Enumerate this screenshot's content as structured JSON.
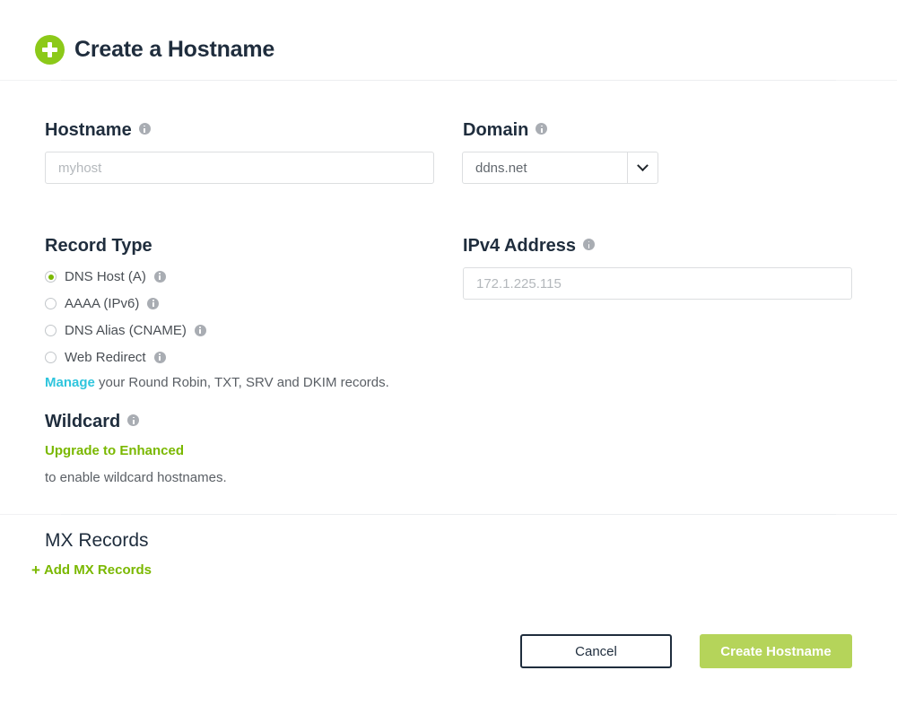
{
  "header": {
    "title": "Create a Hostname",
    "add_icon": "plus-circle-icon"
  },
  "form": {
    "hostname": {
      "label": "Hostname",
      "placeholder": "myhost",
      "value": ""
    },
    "domain": {
      "label": "Domain",
      "selected": "ddns.net",
      "chevron_icon": "chevron-down-icon"
    },
    "record_type": {
      "label": "Record Type",
      "options": [
        {
          "label": "DNS Host (A)",
          "selected": true
        },
        {
          "label": "AAAA (IPv6)",
          "selected": false
        },
        {
          "label": "DNS Alias (CNAME)",
          "selected": false
        },
        {
          "label": "Web Redirect",
          "selected": false
        }
      ],
      "manage_link": "Manage",
      "manage_text": " your Round Robin, TXT, SRV and DKIM records."
    },
    "ipv4": {
      "label": "IPv4 Address",
      "placeholder": "172.1.225.115",
      "value": ""
    },
    "wildcard": {
      "label": "Wildcard",
      "upgrade_link": "Upgrade to Enhanced",
      "note": "to enable wildcard hostnames."
    },
    "mx": {
      "title": "MX Records",
      "add_label": "Add MX Records",
      "add_icon": "plus-icon"
    }
  },
  "footer": {
    "cancel_label": "Cancel",
    "create_label": "Create Hostname"
  },
  "colors": {
    "brand_green": "#8cc919",
    "link_green": "#7ab800",
    "button_green": "#b5d45a",
    "link_cyan": "#2fc5dd",
    "heading_navy": "#1f2d3d"
  }
}
